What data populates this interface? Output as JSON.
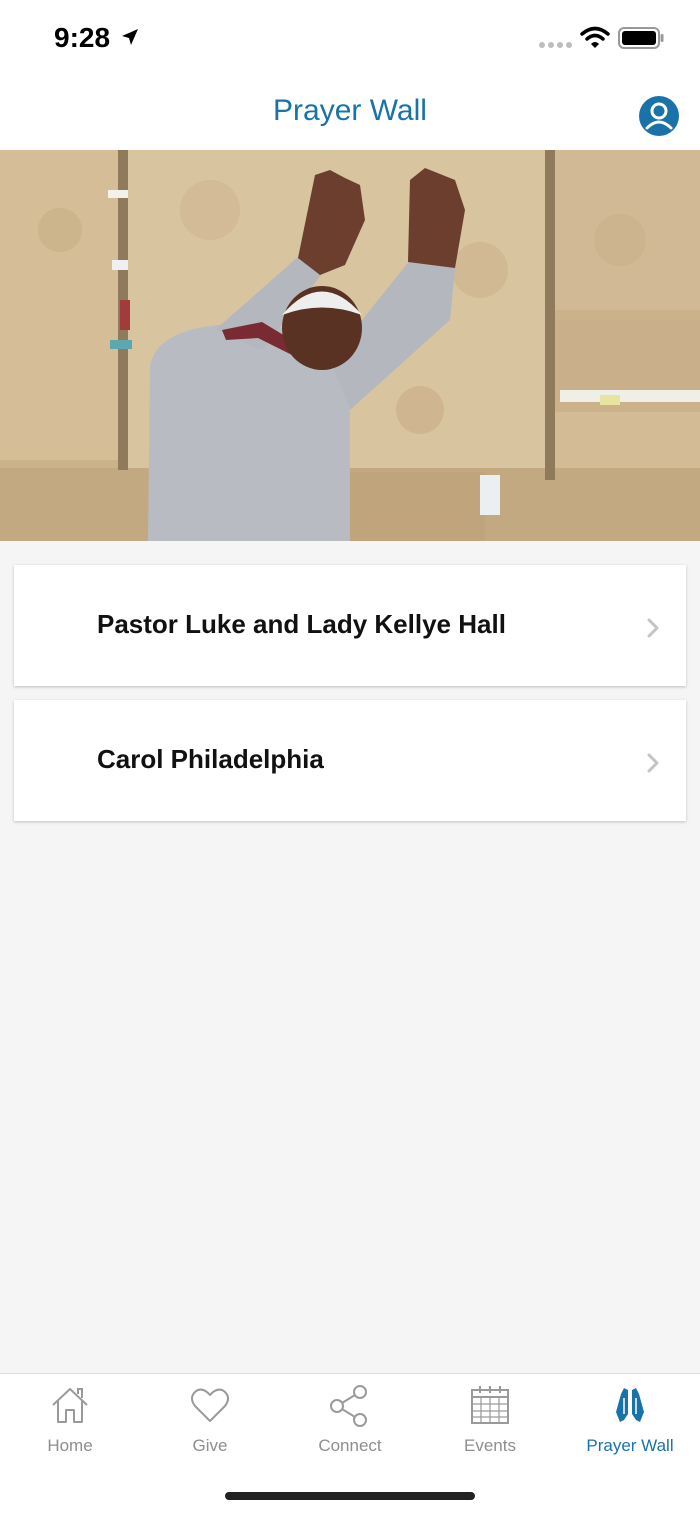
{
  "status_bar": {
    "time": "9:28",
    "icons": [
      "location-arrow-icon",
      "cellular-signal-icon",
      "wifi-icon",
      "battery-icon"
    ]
  },
  "header": {
    "title": "Prayer Wall",
    "profile_icon": "user-profile-icon",
    "accent_color": "#1a73a8"
  },
  "hero": {
    "subject": "person praying with hands on a stone wall"
  },
  "list": {
    "items": [
      {
        "label": "Pastor Luke and Lady Kellye Hall",
        "icon": "chevron-right-icon"
      },
      {
        "label": "Carol Philadelphia",
        "icon": "chevron-right-icon"
      }
    ]
  },
  "tab_bar": {
    "tabs": [
      {
        "label": "Home",
        "icon": "home-icon",
        "active": false
      },
      {
        "label": "Give",
        "icon": "heart-icon",
        "active": false
      },
      {
        "label": "Connect",
        "icon": "share-icon",
        "active": false
      },
      {
        "label": "Events",
        "icon": "calendar-icon",
        "active": false
      },
      {
        "label": "Prayer Wall",
        "icon": "praying-hands-icon",
        "active": true
      }
    ],
    "active_color": "#1a73a8",
    "inactive_color": "#8e8e8e"
  }
}
